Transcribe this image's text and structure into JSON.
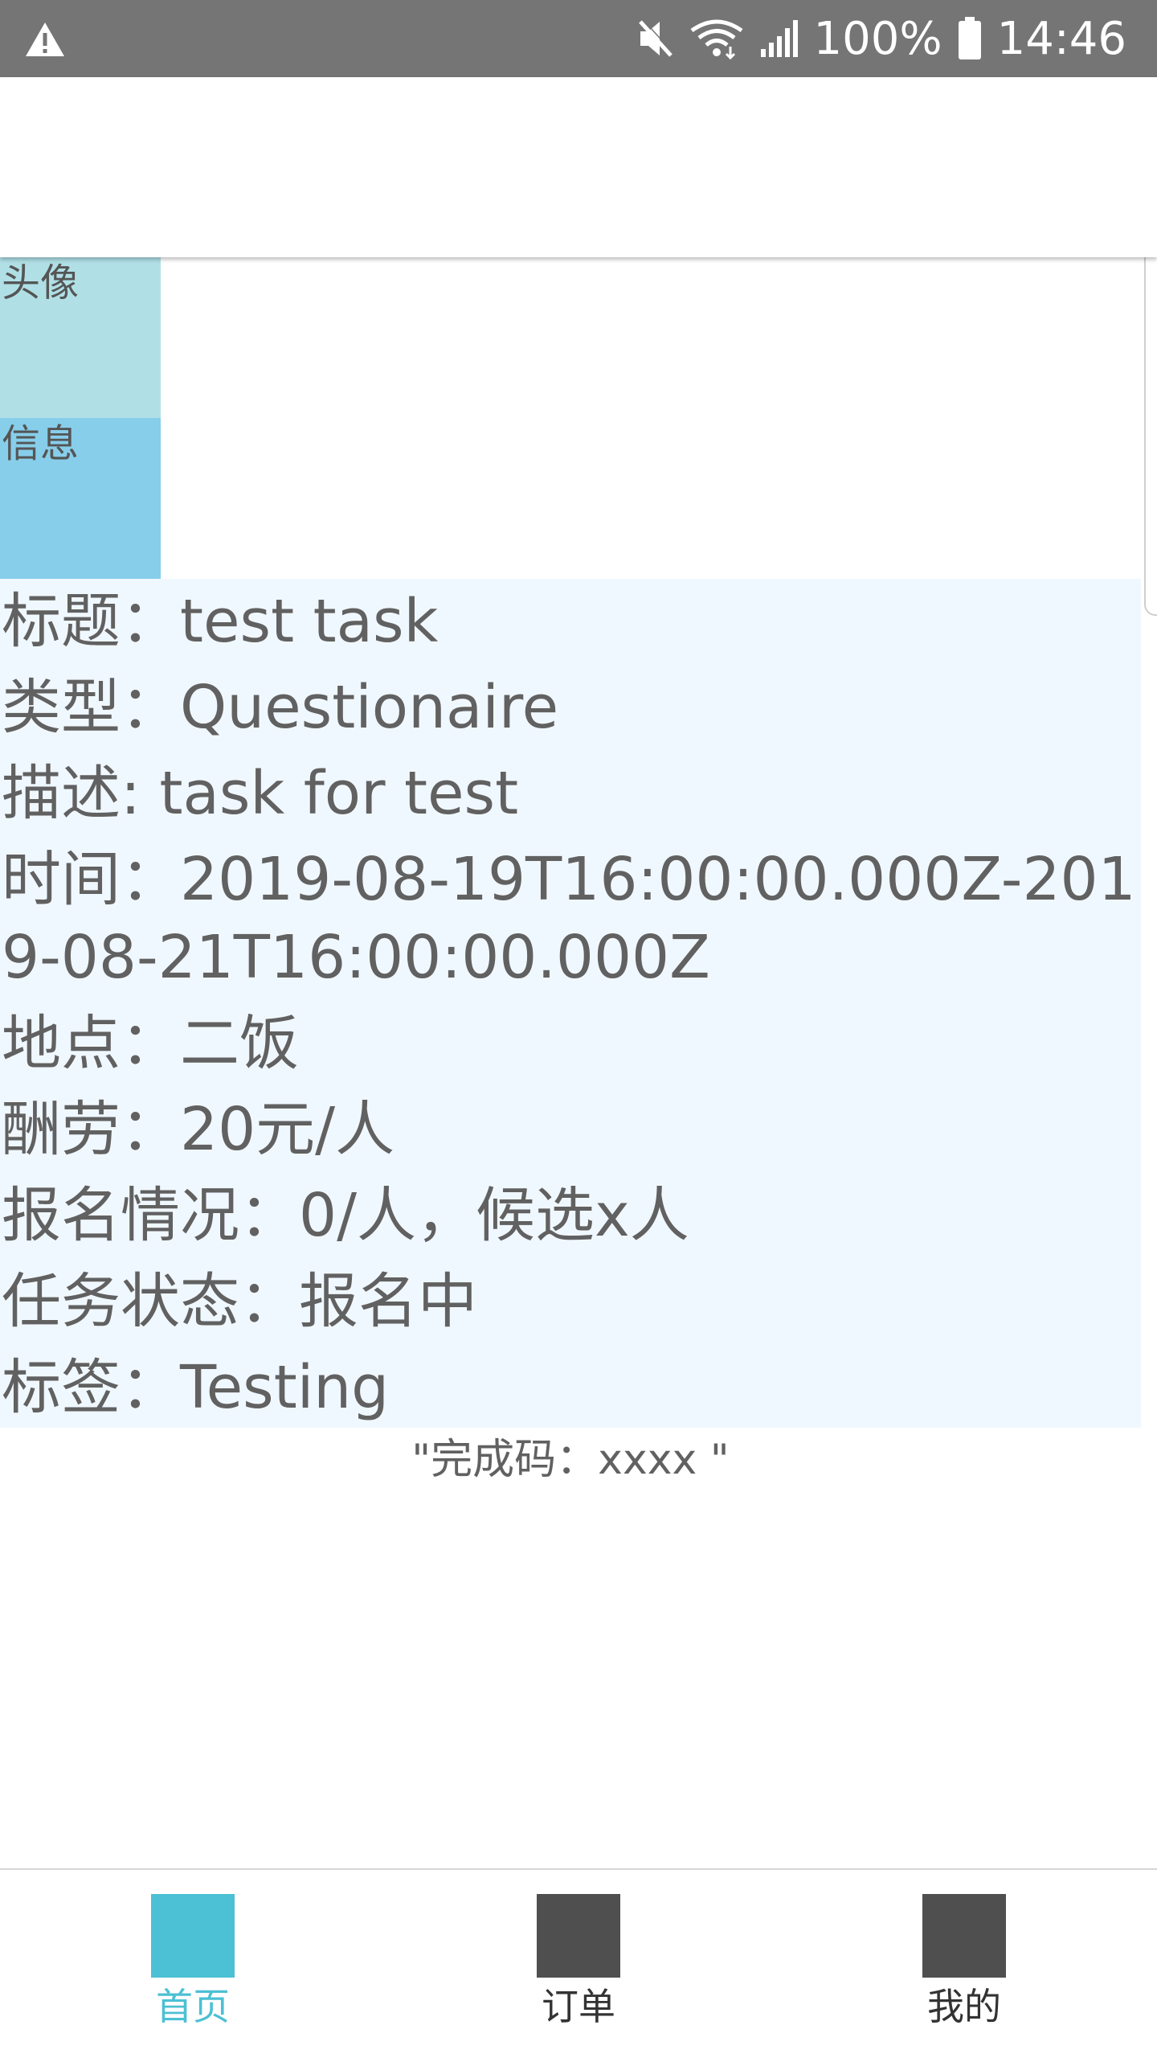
{
  "status_bar": {
    "battery": "100%",
    "time": "14:46",
    "icons": [
      "warning-icon",
      "mute-icon",
      "wifi-icon",
      "signal-icon",
      "battery-icon"
    ]
  },
  "header": {
    "avatar_label": "头像",
    "info_label": "信息"
  },
  "task": {
    "title": "标题：test task",
    "type": "类型：Questionaire",
    "description": "描述: task for test",
    "time": "时间：2019-08-19T16:00:00.000Z-2019-08-21T16:00:00.000Z",
    "location": "地点：二饭",
    "reward": "酬劳：20元/人",
    "enrollment": "报名情况：0/人，候选x人",
    "status": "任务状态：报名中",
    "tag": "标签：Testing",
    "completion_code": "\"完成码：xxxx \""
  },
  "bottom_nav": {
    "items": [
      {
        "label": "首页",
        "color": "#4cc0d4",
        "active": true
      },
      {
        "label": "订单",
        "color": "#4f4f4f",
        "active": false
      },
      {
        "label": "我的",
        "color": "#4f4f4f",
        "active": false
      }
    ]
  },
  "colors": {
    "status_bar": "#757575",
    "avatar_block": "#b0e0e6",
    "info_block": "#87ceeb",
    "details_bg": "#f0f8ff",
    "text": "#616161",
    "accent": "#4cc0d4"
  }
}
